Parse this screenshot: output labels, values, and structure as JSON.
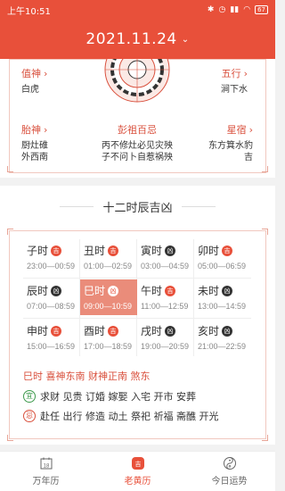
{
  "status": {
    "time": "上午10:51",
    "battery": "67"
  },
  "header": {
    "date": "2021.11.24"
  },
  "top": {
    "zhishen": {
      "title": "值神",
      "value": "白虎"
    },
    "wuxing": {
      "title": "五行",
      "value": "涧下水"
    },
    "taishen": {
      "title": "胎神",
      "values": [
        "厨灶碓",
        "外西南"
      ]
    },
    "pengzu": {
      "title": "彭祖百忌",
      "values": [
        "丙不修灶必见灾殃",
        "子不问卜自惹祸殃"
      ]
    },
    "xingsu": {
      "title": "星宿",
      "values": [
        "东方箕水豹",
        "吉"
      ]
    }
  },
  "section_title": "十二时辰吉凶",
  "hours": [
    {
      "name": "子时",
      "badge": "吉",
      "time": "23:00—00:59",
      "good": true
    },
    {
      "name": "丑时",
      "badge": "吉",
      "time": "01:00—02:59",
      "good": true
    },
    {
      "name": "寅时",
      "badge": "凶",
      "time": "03:00—04:59",
      "good": false
    },
    {
      "name": "卯时",
      "badge": "吉",
      "time": "05:00—06:59",
      "good": true
    },
    {
      "name": "辰时",
      "badge": "凶",
      "time": "07:00—08:59",
      "good": false
    },
    {
      "name": "巳时",
      "badge": "凶",
      "time": "09:00—10:59",
      "good": false,
      "active": true
    },
    {
      "name": "午时",
      "badge": "吉",
      "time": "11:00—12:59",
      "good": true
    },
    {
      "name": "未时",
      "badge": "凶",
      "time": "13:00—14:59",
      "good": false
    },
    {
      "name": "申时",
      "badge": "吉",
      "time": "15:00—16:59",
      "good": true
    },
    {
      "name": "酉时",
      "badge": "吉",
      "time": "17:00—18:59",
      "good": true
    },
    {
      "name": "戌时",
      "badge": "凶",
      "time": "19:00—20:59",
      "good": false
    },
    {
      "name": "亥时",
      "badge": "凶",
      "time": "21:00—22:59",
      "good": false
    }
  ],
  "detail": {
    "head": "巳时 喜神东南 财神正南 煞东",
    "yi_mark": "宜",
    "yi": "求财 见贵 订婚 嫁娶 入宅 开市 安葬",
    "ji_mark": "忌",
    "ji": "赴任 出行 修造 动土 祭祀 祈福 斋醮 开光"
  },
  "tabs": [
    {
      "label": "万年历",
      "icon": "calendar-icon"
    },
    {
      "label": "老黄历",
      "icon": "almanac-icon",
      "active": true
    },
    {
      "label": "今日运势",
      "icon": "yinyang-icon"
    }
  ],
  "colors": {
    "brand": "#e8503a",
    "good": "#3d9a4c"
  }
}
